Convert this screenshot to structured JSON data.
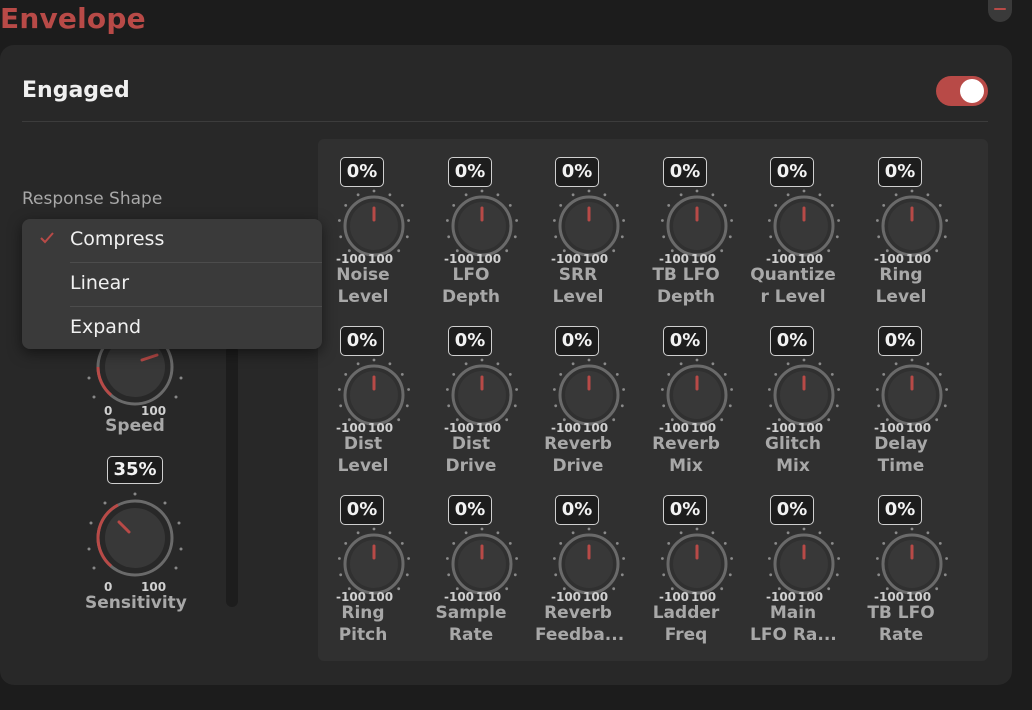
{
  "section": {
    "title": "Envelope"
  },
  "engaged": {
    "label": "Engaged",
    "on": true
  },
  "response_shape": {
    "label": "Response Shape",
    "options": [
      "Compress",
      "Linear",
      "Expand"
    ],
    "selected": "Compress"
  },
  "speed": {
    "label": "Speed",
    "min": "0",
    "max": "100"
  },
  "sensitivity": {
    "label": "Sensitivity",
    "value": "35%",
    "min": "0",
    "max": "100"
  },
  "mod_grid": [
    {
      "value": "0%",
      "min": "-100",
      "max": "100",
      "line1": "Noise",
      "line2": "Level"
    },
    {
      "value": "0%",
      "min": "-100",
      "max": "100",
      "line1": "LFO",
      "line2": "Depth"
    },
    {
      "value": "0%",
      "min": "-100",
      "max": "100",
      "line1": "SRR",
      "line2": "Level"
    },
    {
      "value": "0%",
      "min": "-100",
      "max": "100",
      "line1": "TB LFO",
      "line2": "Depth"
    },
    {
      "value": "0%",
      "min": "-100",
      "max": "100",
      "line1": "Quantize",
      "line2": "r Level"
    },
    {
      "value": "0%",
      "min": "-100",
      "max": "100",
      "line1": "Ring",
      "line2": "Level"
    },
    {
      "value": "0%",
      "min": "-100",
      "max": "100",
      "line1": "Dist",
      "line2": "Level"
    },
    {
      "value": "0%",
      "min": "-100",
      "max": "100",
      "line1": "Dist",
      "line2": "Drive"
    },
    {
      "value": "0%",
      "min": "-100",
      "max": "100",
      "line1": "Reverb",
      "line2": "Drive"
    },
    {
      "value": "0%",
      "min": "-100",
      "max": "100",
      "line1": "Reverb",
      "line2": "Mix"
    },
    {
      "value": "0%",
      "min": "-100",
      "max": "100",
      "line1": "Glitch",
      "line2": "Mix"
    },
    {
      "value": "0%",
      "min": "-100",
      "max": "100",
      "line1": "Delay",
      "line2": "Time"
    },
    {
      "value": "0%",
      "min": "-100",
      "max": "100",
      "line1": "Ring",
      "line2": "Pitch"
    },
    {
      "value": "0%",
      "min": "-100",
      "max": "100",
      "line1": "Sample",
      "line2": "Rate"
    },
    {
      "value": "0%",
      "min": "-100",
      "max": "100",
      "line1": "Reverb",
      "line2": "Feedba..."
    },
    {
      "value": "0%",
      "min": "-100",
      "max": "100",
      "line1": "Ladder",
      "line2": "Freq"
    },
    {
      "value": "0%",
      "min": "-100",
      "max": "100",
      "line1": "Main",
      "line2": "LFO Ra..."
    },
    {
      "value": "0%",
      "min": "-100",
      "max": "100",
      "line1": "TB LFO",
      "line2": "Rate"
    }
  ],
  "colors": {
    "accent": "#b84a47",
    "panel": "#282828",
    "grid": "#303030",
    "knob": "#383838"
  },
  "icons": {
    "minimize": "minus-icon",
    "check": "checkmark-icon"
  }
}
